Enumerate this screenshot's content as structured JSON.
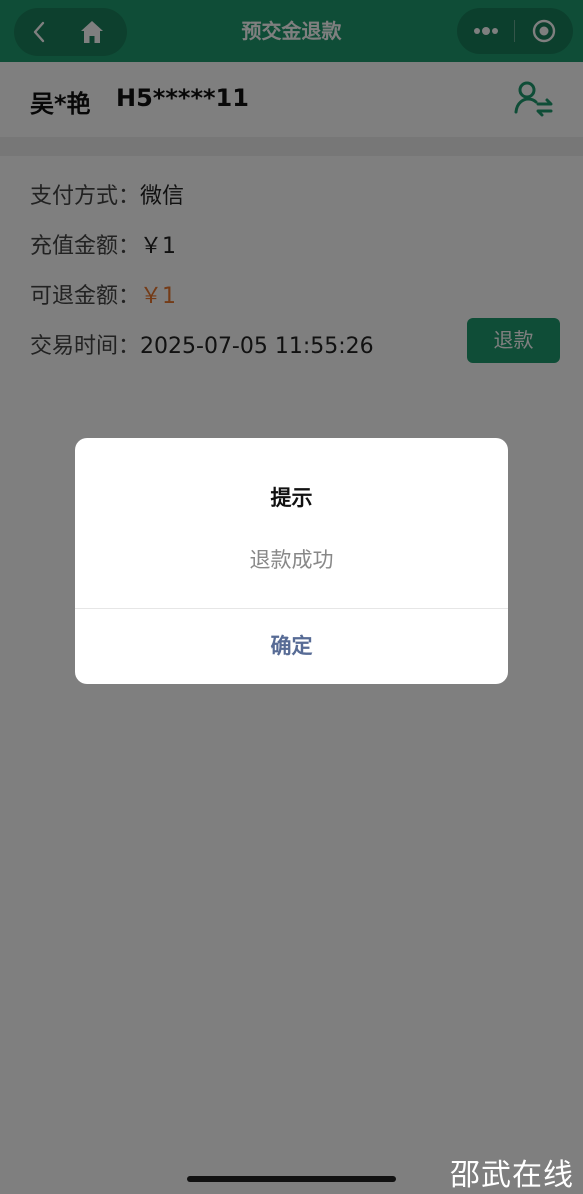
{
  "navbar": {
    "title": "预交金退款",
    "back_icon": "chevron-left-icon",
    "home_icon": "home-icon",
    "more_icon": "more-dots-icon",
    "close_icon": "target-close-icon",
    "color": "#1f9a6e"
  },
  "patient": {
    "name": "吴*艳",
    "id": "H5*****11",
    "switch_icon": "switch-patient-icon"
  },
  "record": {
    "pay_method_label": "支付方式：",
    "pay_method_value": "微信",
    "recharge_label": "充值金额：",
    "recharge_value": "￥1",
    "refundable_label": "可退金额：",
    "refundable_value": "￥1",
    "time_label": "交易时间：",
    "time_value": "2025-07-05 11:55:26",
    "refund_button": "退款"
  },
  "dialog": {
    "title": "提示",
    "message": "退款成功",
    "confirm": "确定"
  },
  "watermark": "邵武在线",
  "colors": {
    "accent": "#1f9a6e",
    "amount_orange": "#e8772e",
    "dialog_link": "#576b95"
  }
}
